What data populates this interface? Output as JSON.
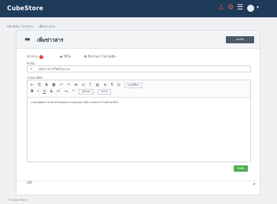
{
  "app": {
    "brand": "CubeStore",
    "user_caret": "▾"
  },
  "topbar_icons": [
    {
      "name": "alert-icon",
      "glyph": "⚠",
      "color": "#f05a4a"
    },
    {
      "name": "settings-icon",
      "glyph": "⚙",
      "color": "#f05a4a"
    },
    {
      "name": "menu-icon",
      "glyph": "☰",
      "color": "#ffffff"
    }
  ],
  "breadcrumb": [
    "หน้าหลัก / ข่าวสาร",
    "เพิ่มข่าวสาร"
  ],
  "panel": {
    "title": "เพิ่มข่าวสาร",
    "title_icon": "▬",
    "back_button": "◂ กลับ"
  },
  "type_options": [
    {
      "label": "ข่าวสาร",
      "icon": "",
      "selected": true
    },
    {
      "label": "◉ วิดีโอ",
      "icon": "",
      "selected": false
    },
    {
      "label": "✿ กิจกรรม / โปรโมชั่น",
      "icon": "",
      "selected": false
    }
  ],
  "form": {
    "title_label": "หัวข้อ",
    "title_value": "เพิ่มข่าวสารใหม่ในระบบ",
    "title_icon": "✎",
    "content_label": "รายละเอียด",
    "toolbar_row1": [
      "⇤",
      "⎘",
      "⧉",
      "🖶",
      "↶",
      "↷",
      "⊞",
      "≡",
      "T",
      "▤",
      "≣",
      "¶",
      "Ω"
    ],
    "toolbar_row1_select": "แหล่งที่มา",
    "toolbar_row2": [
      "B",
      "I",
      "U",
      "S",
      "x²",
      "x₂",
      "❝"
    ],
    "toolbar_row2_selects": [
      "รูปแบบ",
      "ขนาด"
    ],
    "content_text": "รายละเอียดข่าวสารสำหรับทดสอบการแสดงผลภายในระบบจัดการร้านค้าออนไลน์",
    "tags_label": "แท็ก",
    "resize_icon": "◢",
    "save_button": "บันทึก"
  },
  "footer": "© Cube Store"
}
